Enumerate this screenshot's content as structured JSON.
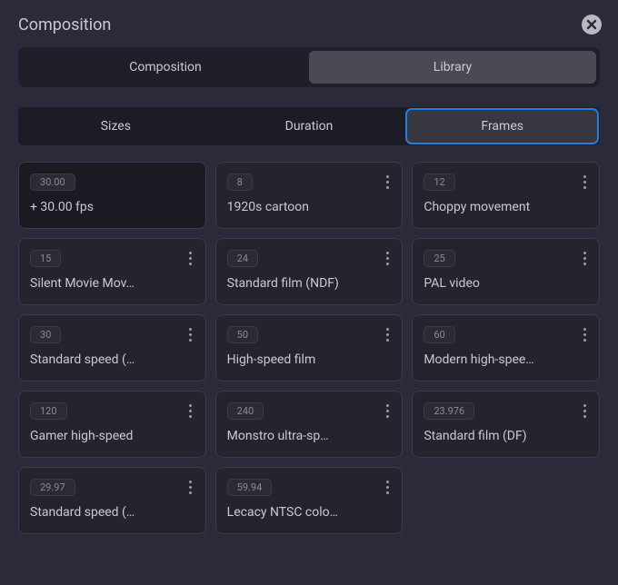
{
  "header": {
    "title": "Composition"
  },
  "top_tabs": [
    {
      "label": "Composition",
      "active": false
    },
    {
      "label": "Library",
      "active": true
    }
  ],
  "sub_tabs": [
    {
      "label": "Sizes",
      "active": false
    },
    {
      "label": "Duration",
      "active": false
    },
    {
      "label": "Frames",
      "active": true
    }
  ],
  "presets": [
    {
      "badge": "30.00",
      "label": "+ 30.00 fps",
      "dark": true,
      "more": false
    },
    {
      "badge": "8",
      "label": "1920s cartoon",
      "dark": false,
      "more": true
    },
    {
      "badge": "12",
      "label": "Choppy movement",
      "dark": false,
      "more": true
    },
    {
      "badge": "15",
      "label": "Silent Movie Mov…",
      "dark": false,
      "more": true
    },
    {
      "badge": "24",
      "label": "Standard film (NDF)",
      "dark": false,
      "more": true
    },
    {
      "badge": "25",
      "label": "PAL video",
      "dark": false,
      "more": true
    },
    {
      "badge": "30",
      "label": "Standard speed (…",
      "dark": false,
      "more": true
    },
    {
      "badge": "50",
      "label": "High-speed film",
      "dark": false,
      "more": true
    },
    {
      "badge": "60",
      "label": "Modern high-spee…",
      "dark": false,
      "more": true
    },
    {
      "badge": "120",
      "label": "Gamer high-speed",
      "dark": false,
      "more": true
    },
    {
      "badge": "240",
      "label": "Monstro ultra-sp…",
      "dark": false,
      "more": true
    },
    {
      "badge": "23.976",
      "label": "Standard film (DF)",
      "dark": false,
      "more": true
    },
    {
      "badge": "29.97",
      "label": "Standard speed (…",
      "dark": false,
      "more": true
    },
    {
      "badge": "59.94",
      "label": "Lecacy NTSC colo…",
      "dark": false,
      "more": true
    }
  ]
}
